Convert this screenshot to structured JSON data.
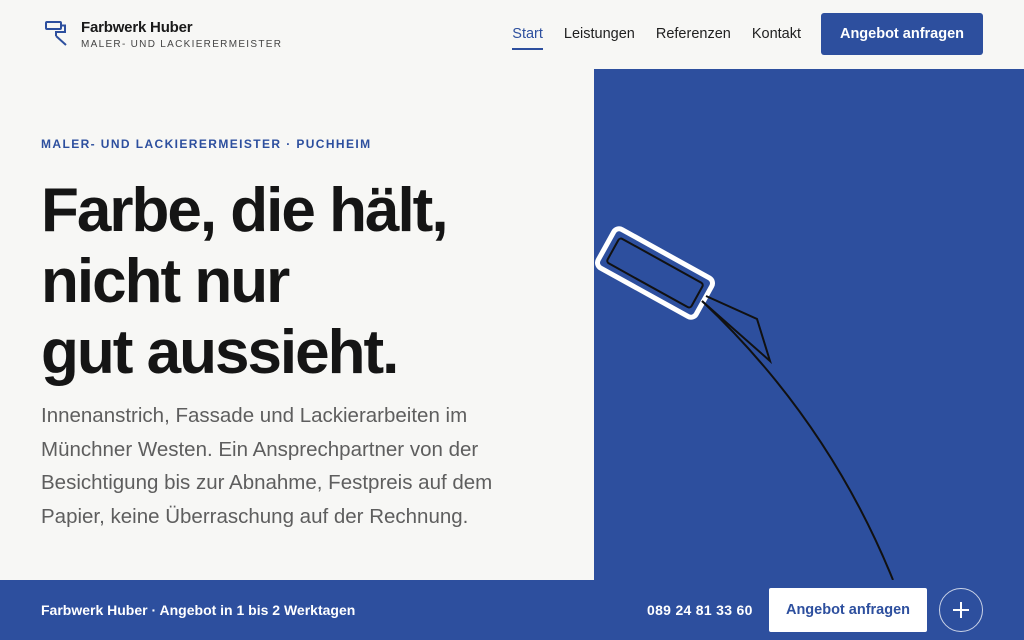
{
  "header": {
    "brand_name": "Farbwerk Huber",
    "brand_sub": "MALER- UND LACKIERERMEISTER",
    "logo_icon": "paint-roller-icon",
    "nav": [
      {
        "label": "Start",
        "active": true
      },
      {
        "label": "Leistungen",
        "active": false
      },
      {
        "label": "Referenzen",
        "active": false
      },
      {
        "label": "Kontakt",
        "active": false
      }
    ],
    "cta_label": "Angebot anfragen"
  },
  "hero": {
    "eyebrow": "MALER- UND LACKIERERMEISTER · PUCHHEIM",
    "headline_lines": [
      "Farbe, die hält,",
      "nicht nur",
      "gut aussieht."
    ],
    "lead": "Innenanstrich, Fassade und Lackierarbeiten im Münchner Westen. Ein Ansprechpartner von der Besichtigung bis zur Abnahme, Festpreis auf dem Papier, keine Überraschung auf der Rechnung.",
    "visual_icon": "paint-roller-illustration"
  },
  "bar": {
    "brand": "Farbwerk Huber",
    "text": " · Angebot in 1 bis 2 Werktagen",
    "phone": "089 24 81 33 60",
    "cta_label": "Angebot anfragen",
    "plus_icon": "plus-icon"
  },
  "colors": {
    "accent": "#2d4f9e",
    "background": "#f7f7f5",
    "text": "#151515",
    "muted": "#5e5e5e"
  }
}
